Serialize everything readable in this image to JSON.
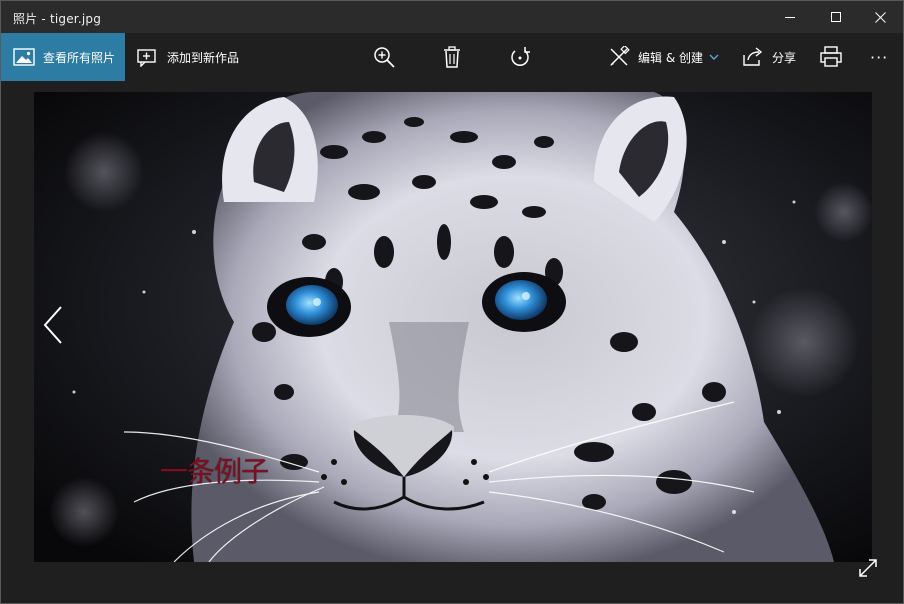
{
  "window": {
    "title": "照片 - tiger.jpg",
    "controls": {
      "minimize": "minimize-icon",
      "maximize": "maximize-icon",
      "close": "close-icon"
    }
  },
  "toolbar": {
    "view_all_label": "查看所有照片",
    "add_to_creation_label": "添加到新作品",
    "zoom_icon": "zoom-in-icon",
    "delete_icon": "trash-icon",
    "rotate_icon": "rotate-icon",
    "edit_label": "编辑 & 创建",
    "share_label": "分享",
    "print_icon": "print-icon",
    "more_label": "···"
  },
  "viewer": {
    "image_name": "tiger.jpg",
    "watermark_text": "一条例子",
    "prev_icon": "chevron-left-icon",
    "expand_icon": "fullscreen-icon"
  },
  "colors": {
    "accent": "#2d7ca3",
    "titlebar": "#2b2b2b",
    "toolbar": "#1f1f1f",
    "watermark": "#7a1020",
    "eyes": "#2f8fd8"
  }
}
